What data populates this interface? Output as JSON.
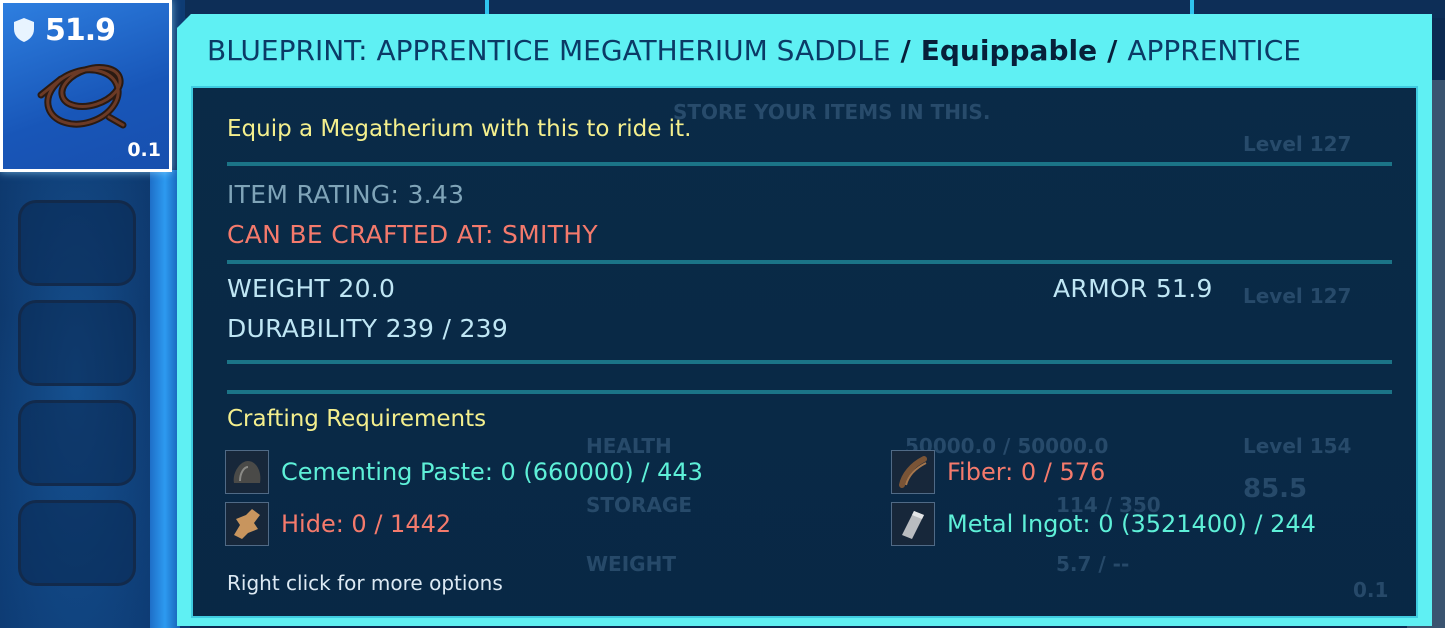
{
  "slot": {
    "armor": "51.9",
    "weight": "0.1"
  },
  "tooltip": {
    "title_name": "BLUEPRINT: APPRENTICE MEGATHERIUM SADDLE",
    "separator": "/",
    "type": "Equippable",
    "quality": "APPRENTICE",
    "description": "Equip a Megatherium with this to ride it.",
    "item_rating": "ITEM RATING: 3.43",
    "crafted_at": "CAN BE CRAFTED AT: SMITHY",
    "weight": "WEIGHT 20.0",
    "armor": "ARMOR 51.9",
    "durability": "DURABILITY 239 / 239",
    "requirements_title": "Crafting Requirements",
    "requirements": [
      {
        "icon": "cementing-paste-icon",
        "text": "Cementing Paste: 0 (660000) / 443",
        "status": "have"
      },
      {
        "icon": "fiber-icon",
        "text": "Fiber: 0 / 576",
        "status": "missing"
      },
      {
        "icon": "hide-icon",
        "text": "Hide: 0 / 1442",
        "status": "missing"
      },
      {
        "icon": "metal-ingot-icon",
        "text": "Metal Ingot: 0 (3521400) / 244",
        "status": "have"
      }
    ],
    "footer": "Right click for more options"
  },
  "background": {
    "store_hint": "STORE YOUR ITEMS IN THIS.",
    "health_label": "HEALTH",
    "health_value": "50000.0 / 50000.0",
    "storage_label": "STORAGE",
    "storage_value": "114 / 350",
    "weight_label": "WEIGHT",
    "weight_value": "5.7 / --",
    "level_1": "Level 127",
    "level_2": "Level 127",
    "level_3": "Level 154",
    "slot_weight": "0.1",
    "armor_preview": "85.5"
  },
  "colors": {
    "accent": "#5ff0f3",
    "have": "#5ef0d8",
    "missing": "#f47a6c",
    "heading": "#f4ef8d"
  }
}
